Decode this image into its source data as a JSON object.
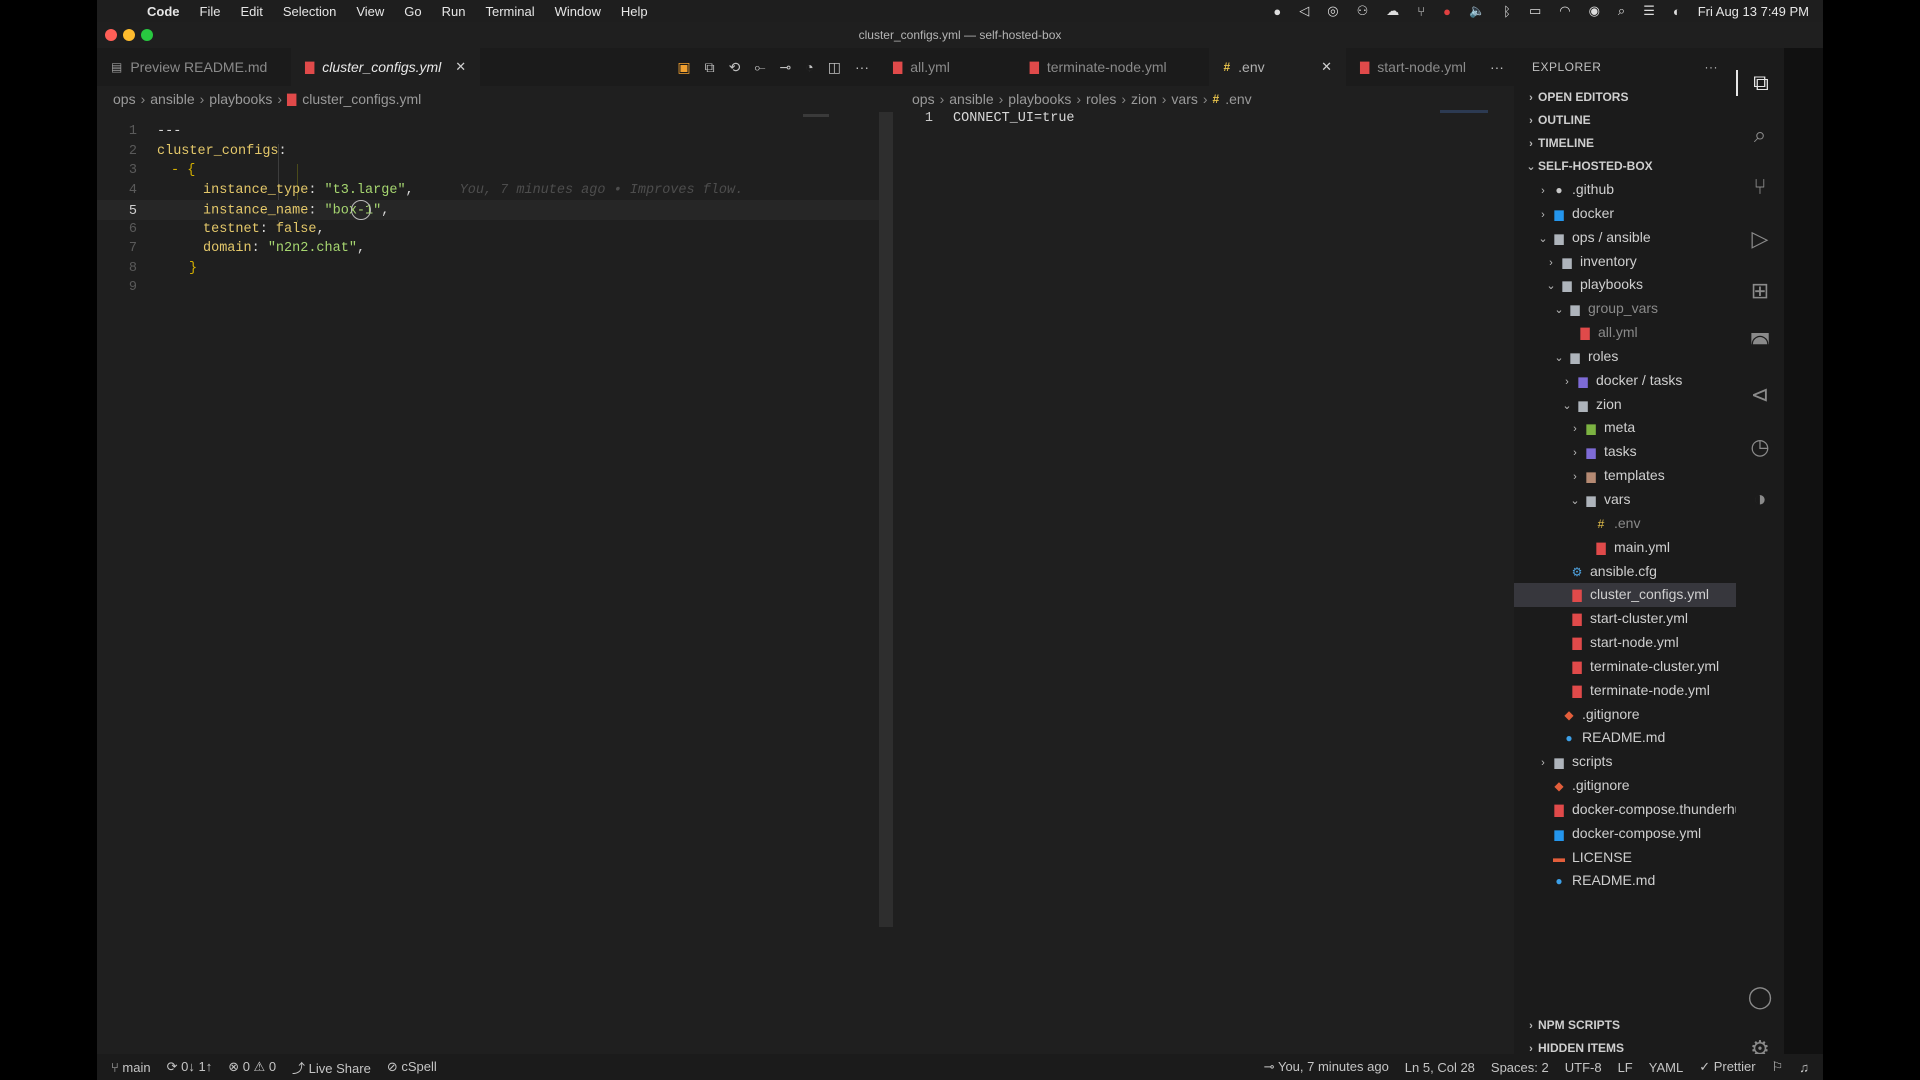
{
  "menubar": {
    "apple_icon": "apple-icon",
    "items": [
      "Code",
      "File",
      "Edit",
      "Selection",
      "View",
      "Go",
      "Run",
      "Terminal",
      "Window",
      "Help"
    ],
    "clock": "Fri Aug 13  7:49 PM"
  },
  "window": {
    "title": "cluster_configs.yml — self-hosted-box"
  },
  "left_tabs": {
    "tab1": "Preview README.md",
    "tab2": "cluster_configs.yml"
  },
  "right_tabs": {
    "tab1": "all.yml",
    "tab2": "terminate-node.yml",
    "tab3": ".env",
    "tab4": "start-node.yml"
  },
  "left_breadcrumb": [
    "ops",
    "ansible",
    "playbooks",
    "cluster_configs.yml"
  ],
  "right_breadcrumb": [
    "ops",
    "ansible",
    "playbooks",
    "roles",
    "zion",
    "vars",
    ".env"
  ],
  "left_editor": {
    "line_numbers": [
      "1",
      "2",
      "3",
      "4",
      "5",
      "6",
      "7",
      "8",
      "9"
    ],
    "l1": "---",
    "l2_key": "cluster_configs",
    "l3_dash": "- {",
    "l4_key": "instance_type",
    "l4_val": "\"t3.large\"",
    "l4_blame": "You, 7 minutes ago • Improves flow.",
    "l5_key": "instance_name",
    "l5_val": "\"box-1\"",
    "l6_key": "testnet",
    "l6_val": "false",
    "l7_key": "domain",
    "l7_val": "\"n2n2.chat\"",
    "l8": "}"
  },
  "right_editor": {
    "line_number": "1",
    "content": "CONNECT_UI=true"
  },
  "explorer": {
    "title": "EXPLORER",
    "more": "···",
    "sections": {
      "open_editors": "OPEN EDITORS",
      "outline": "OUTLINE",
      "timeline": "TIMELINE",
      "project": "SELF-HOSTED-BOX",
      "npm": "NPM SCRIPTS",
      "hidden": "HIDDEN ITEMS"
    },
    "tree": {
      "github": ".github",
      "docker": "docker",
      "ops_ansible": "ops / ansible",
      "inventory": "inventory",
      "playbooks": "playbooks",
      "group_vars": "group_vars",
      "all_yml": "all.yml",
      "roles": "roles",
      "docker_tasks": "docker / tasks",
      "zion": "zion",
      "meta": "meta",
      "tasks": "tasks",
      "templates": "templates",
      "vars": "vars",
      "env": ".env",
      "main_yml": "main.yml",
      "ansible_cfg": "ansible.cfg",
      "cluster_configs": "cluster_configs.yml",
      "start_cluster": "start-cluster.yml",
      "start_node": "start-node.yml",
      "terminate_cluster": "terminate-cluster.yml",
      "terminate_node": "terminate-node.yml",
      "gitignore_pb": ".gitignore",
      "readme_pb": "README.md",
      "scripts": "scripts",
      "gitignore_root": ".gitignore",
      "compose_thunderhub": "docker-compose.thunderhub...",
      "compose": "docker-compose.yml",
      "license": "LICENSE",
      "readme_root": "README.md"
    }
  },
  "statusbar": {
    "branch": "main",
    "sync": "0↓ 1↑",
    "problems": "⊗ 0  ⚠ 0",
    "liveshare": "Live Share",
    "cspell": "cSpell",
    "blame": "You, 7 minutes ago",
    "position": "Ln 5, Col 28",
    "spaces": "Spaces: 2",
    "encoding": "UTF-8",
    "eol": "LF",
    "language": "YAML",
    "prettier": "✓ Prettier"
  }
}
